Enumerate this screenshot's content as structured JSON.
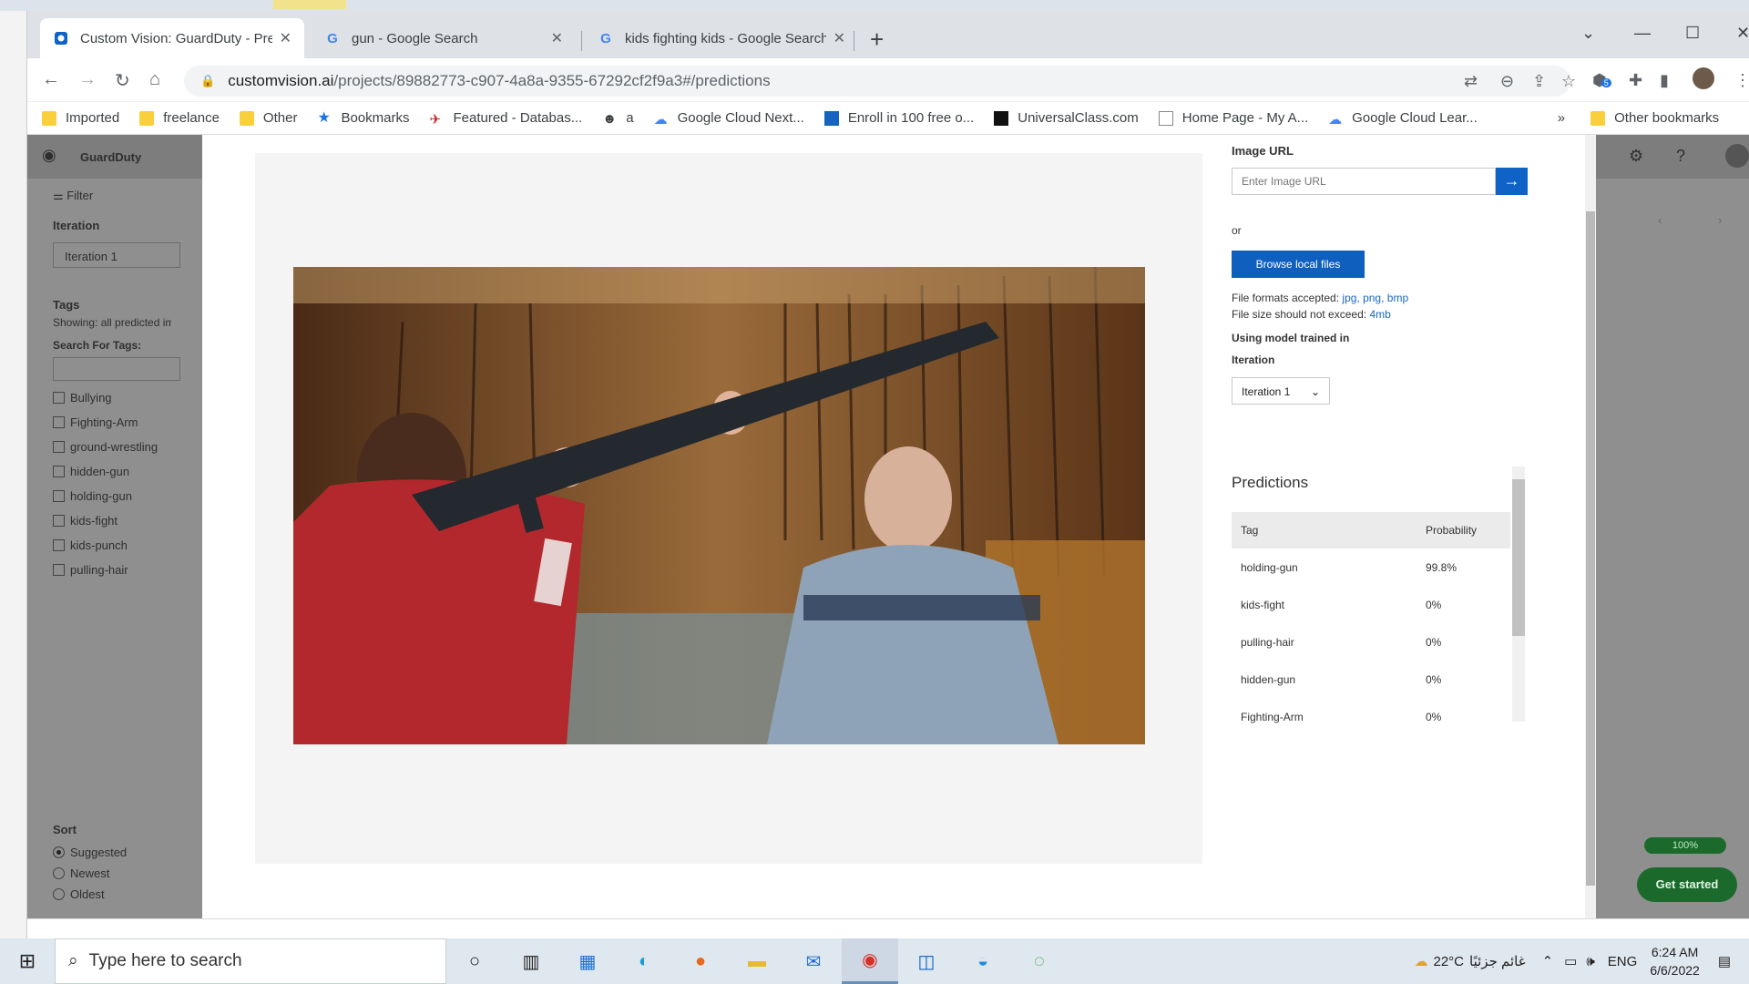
{
  "browser": {
    "tabs": [
      {
        "title": "Custom Vision: GuardDuty - Predictions",
        "active": true
      },
      {
        "title": "gun - Google Search",
        "active": false
      },
      {
        "title": "kids fighting kids - Google Search",
        "active": false
      }
    ],
    "new_tab": "+",
    "url_host": "customvision.ai",
    "url_path": "/projects/89882773-c907-4a8a-9355-67292cf2f9a3#/predictions",
    "extension_badge": "5",
    "bookmarks": [
      {
        "label": "Imported",
        "icon": "folder-icon"
      },
      {
        "label": "freelance",
        "icon": "folder-icon"
      },
      {
        "label": "Other",
        "icon": "folder-icon"
      },
      {
        "label": "Bookmarks",
        "icon": "star-icon"
      },
      {
        "label": "Featured - Databas...",
        "icon": "site-icon"
      },
      {
        "label": "a",
        "icon": "site-icon"
      },
      {
        "label": "Google Cloud Next...",
        "icon": "google-cloud-icon"
      },
      {
        "label": "Enroll in 100 free o...",
        "icon": "site-icon"
      },
      {
        "label": "UniversalClass.com",
        "icon": "site-icon"
      },
      {
        "label": "Home Page - My A...",
        "icon": "site-icon"
      },
      {
        "label": "Google Cloud Lear...",
        "icon": "google-cloud-icon"
      }
    ],
    "more_bookmarks": "»",
    "other_bookmarks": "Other bookmarks"
  },
  "cv": {
    "project": "GuardDuty",
    "filter": "Filter",
    "iteration_heading": "Iteration",
    "iteration_value": "Iteration 1",
    "tags_heading": "Tags",
    "tags_showing": "Showing: all predicted images",
    "search_tags": "Search For Tags:",
    "tags": [
      "Bullying",
      "Fighting-Arm",
      "ground-wrestling",
      "hidden-gun",
      "holding-gun",
      "kids-fight",
      "kids-punch",
      "pulling-hair"
    ],
    "sort_heading": "Sort",
    "sort_options": [
      "Suggested",
      "Newest",
      "Oldest"
    ],
    "progress_badge": "100%",
    "get_started": "Get started"
  },
  "modal": {
    "image_url_label": "Image URL",
    "image_url_placeholder": "Enter Image URL",
    "or": "or",
    "browse_button": "Browse local files",
    "formats_prefix": "File formats accepted:",
    "formats": "jpg, png, bmp",
    "size_prefix": "File size should not exceed:",
    "size": "4mb",
    "model_label": "Using model trained in",
    "iteration_label": "Iteration",
    "iteration_value": "Iteration 1",
    "predictions_title": "Predictions",
    "col_tag": "Tag",
    "col_probability": "Probability",
    "predictions": [
      {
        "tag": "holding-gun",
        "probability": "99.8%"
      },
      {
        "tag": "kids-fight",
        "probability": "0%"
      },
      {
        "tag": "pulling-hair",
        "probability": "0%"
      },
      {
        "tag": "hidden-gun",
        "probability": "0%"
      },
      {
        "tag": "Fighting-Arm",
        "probability": "0%"
      }
    ]
  },
  "taskbar": {
    "search_placeholder": "Type here to search",
    "weather": "22°C",
    "weather_text": "غائم جزئيًا",
    "language": "ENG",
    "time": "6:24 AM",
    "date": "6/6/2022"
  },
  "colors": {
    "accent": "#0f62c6",
    "success": "#1b6a2b"
  }
}
